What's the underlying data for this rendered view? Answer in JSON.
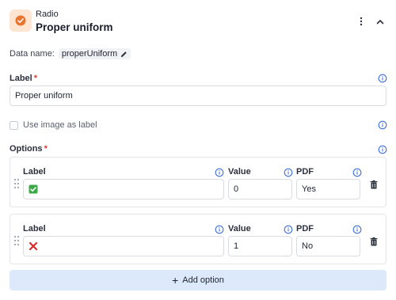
{
  "header": {
    "type_label": "Radio",
    "title": "Proper uniform",
    "icon": "check-circle-icon",
    "accent_color": "#e8742e"
  },
  "data_name": {
    "label": "Data name:",
    "value": "properUniform"
  },
  "label_field": {
    "label": "Label",
    "required_mark": "*",
    "value": "Proper uniform"
  },
  "image_as_label": {
    "label": "Use image as label",
    "checked": false
  },
  "options": {
    "label": "Options",
    "required_mark": "*",
    "columns": {
      "label": "Label",
      "value": "Value",
      "pdf": "PDF"
    },
    "items": [
      {
        "label_icon": "green-check-emoji",
        "value": "0",
        "pdf": "Yes"
      },
      {
        "label_icon": "red-cross-emoji",
        "value": "1",
        "pdf": "No"
      }
    ]
  },
  "add_option": {
    "label": "Add option"
  }
}
